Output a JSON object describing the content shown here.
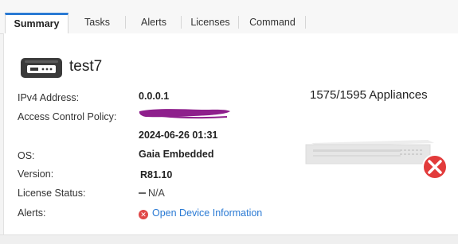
{
  "tabs": [
    {
      "label": "Summary",
      "active": true
    },
    {
      "label": "Tasks",
      "active": false
    },
    {
      "label": "Alerts",
      "active": false
    },
    {
      "label": "Licenses",
      "active": false
    },
    {
      "label": "Command",
      "active": false
    }
  ],
  "device": {
    "name": "test7",
    "icon": "gateway-device-icon"
  },
  "fields": {
    "ipv4_label": "IPv4 Address:",
    "ipv4_value": "0.0.0.1",
    "policy_label": "Access Control Policy:",
    "policy_value_redacted": true,
    "policy_date": "2024-06-26 01:31",
    "os_label": "OS:",
    "os_value": "Gaia Embedded",
    "version_label": "Version:",
    "version_value": "R81.10",
    "license_label": "License Status:",
    "license_value": "N/A",
    "license_icon": "dash-icon",
    "alerts_label": "Alerts:",
    "alerts_link": "Open Device Information",
    "alerts_icon": "error-circle-icon"
  },
  "appliance": {
    "series_text": "1575/1595 Appliances",
    "status_icon": "error-x-icon"
  },
  "colors": {
    "accent": "#2a7ad4",
    "error": "#e04848",
    "redaction": "#8e1f8c"
  }
}
